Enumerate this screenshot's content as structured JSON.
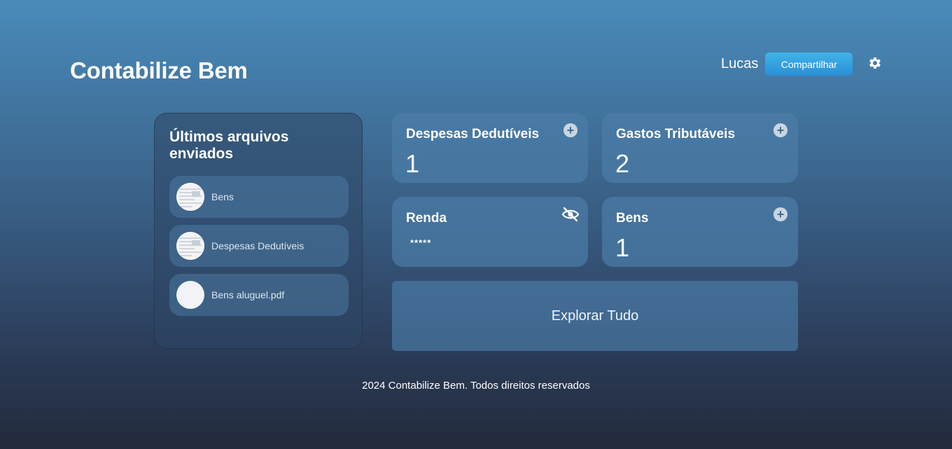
{
  "header": {
    "title": "Contabilize Bem",
    "user_name": "Lucas",
    "share_label": "Compartilhar",
    "settings_icon": "gear-icon"
  },
  "recent_files": {
    "title": "Últimos arquivos enviados",
    "items": [
      {
        "label": "Bens",
        "thumb": "document-thumbnail"
      },
      {
        "label": "Despesas Dedutíveis",
        "thumb": "document-thumbnail"
      },
      {
        "label": "Bens aluguel.pdf",
        "thumb": "blank-thumbnail"
      }
    ]
  },
  "cards": {
    "deductible": {
      "title": "Despesas Dedutíveis",
      "value": "1",
      "action_icon": "plus-icon"
    },
    "taxable": {
      "title": "Gastos Tributáveis",
      "value": "2",
      "action_icon": "plus-icon"
    },
    "income": {
      "title": "Renda",
      "value": "*****",
      "action_icon": "eye-off-icon"
    },
    "assets": {
      "title": "Bens",
      "value": "1",
      "action_icon": "plus-icon"
    }
  },
  "explore_label": "Explorar Tudo",
  "footer": "2024 Contabilize Bem. Todos direitos reservados",
  "colors": {
    "share_button": "#2a8fd6",
    "card_bg": "#4b7da8",
    "background_top": "#4a8bbb",
    "background_bottom": "#222a3b"
  }
}
